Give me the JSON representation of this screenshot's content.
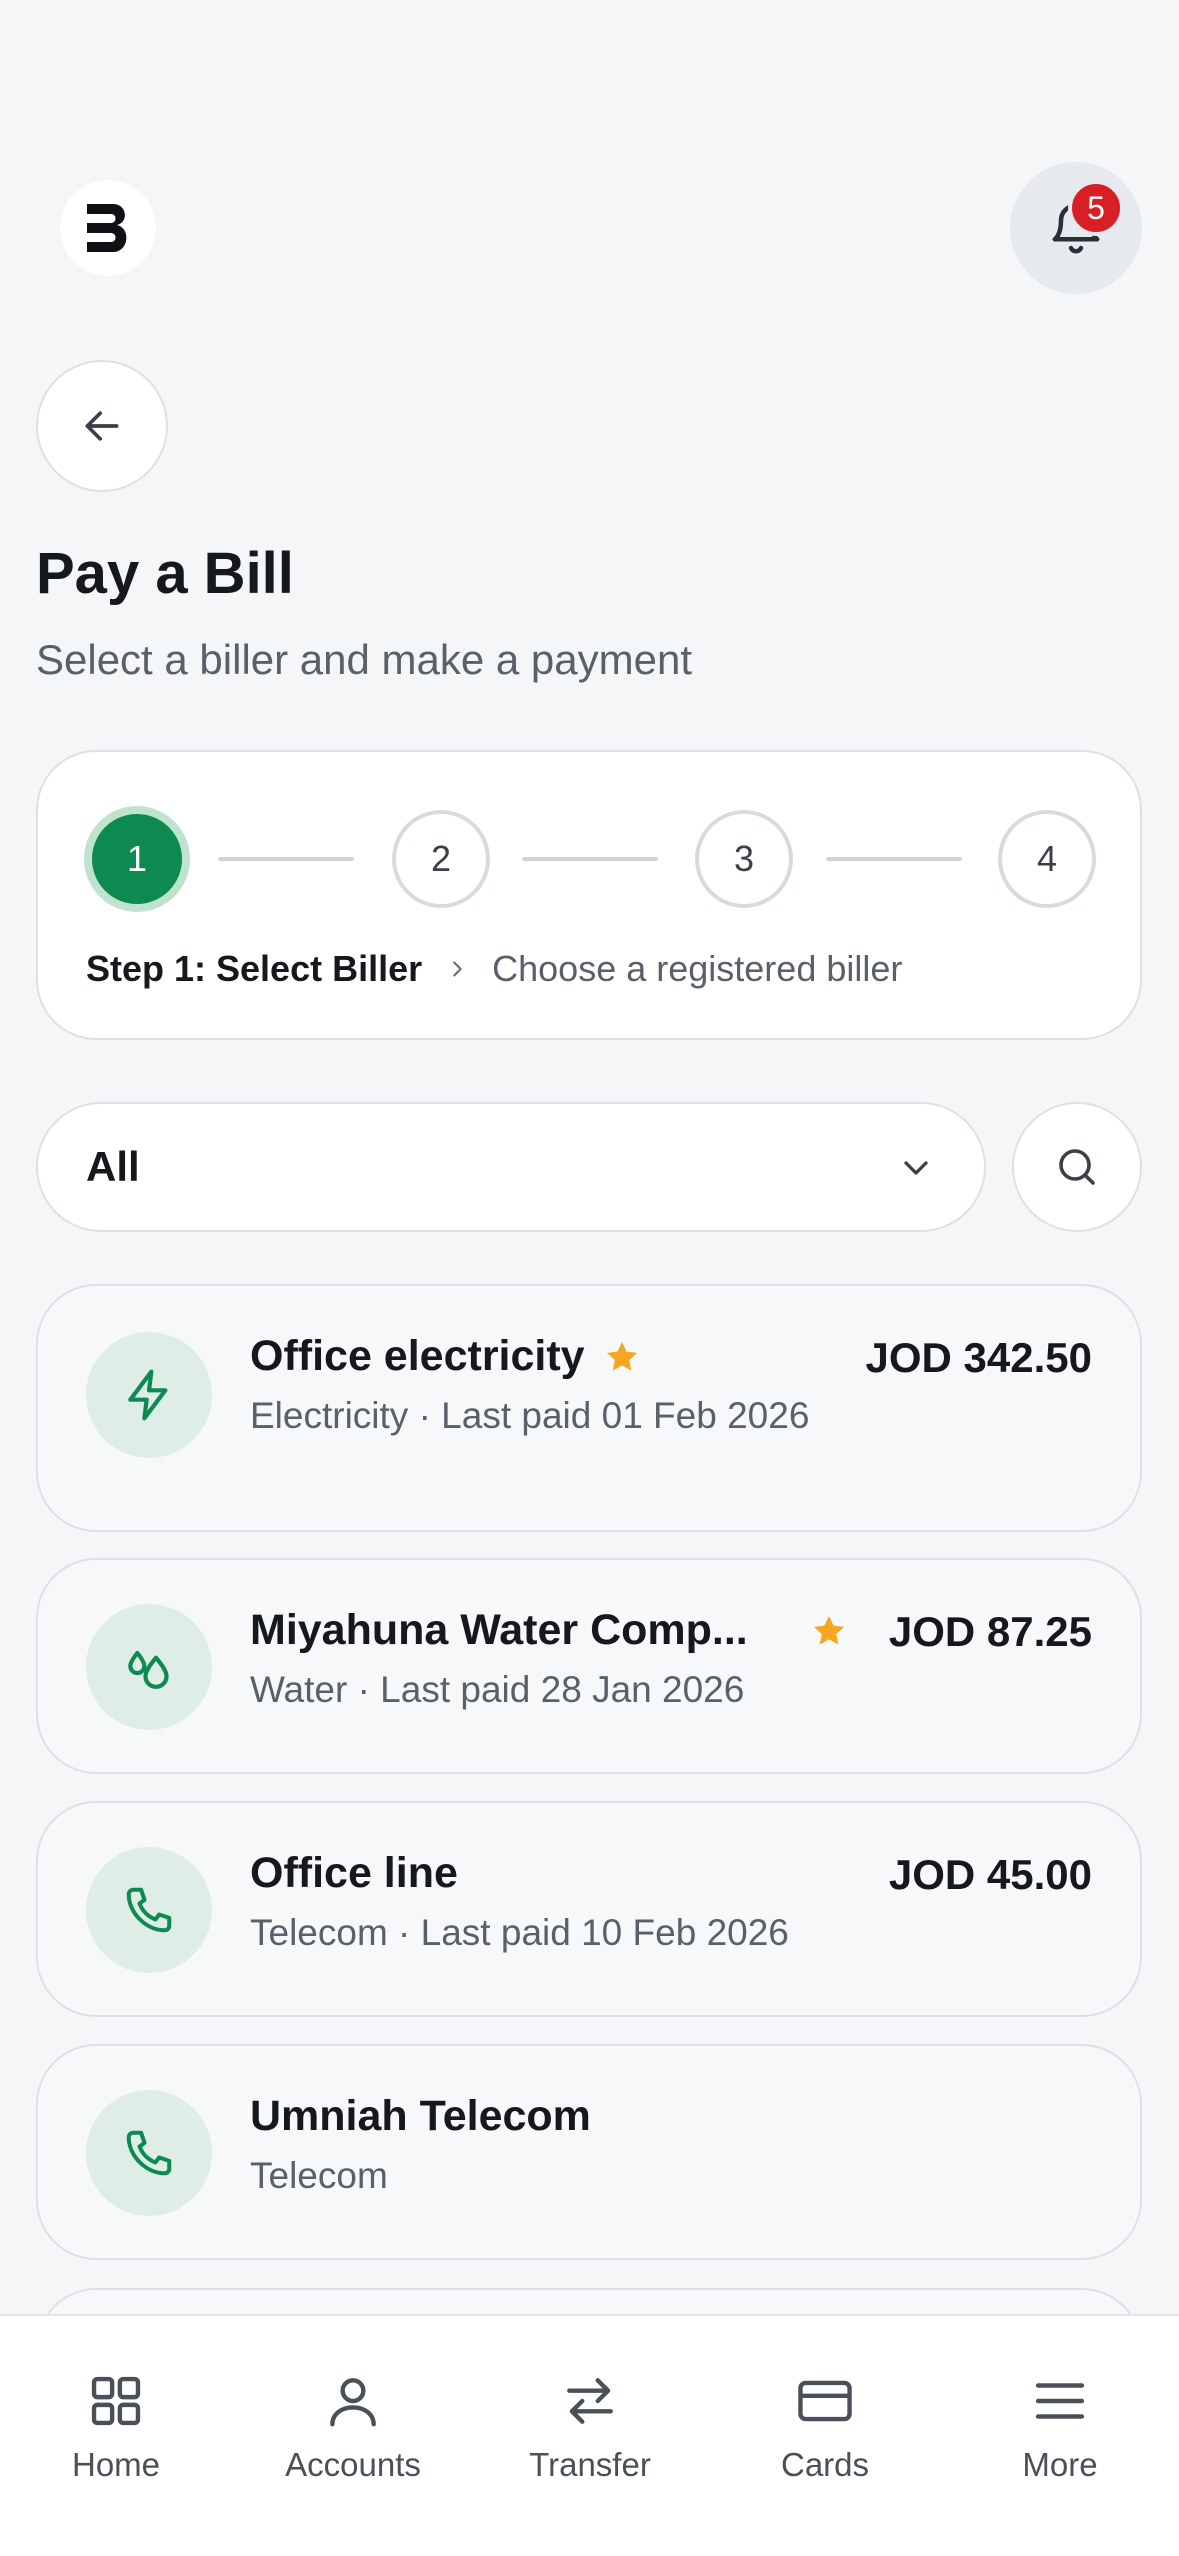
{
  "header": {
    "notifications_count": "5"
  },
  "page": {
    "title": "Pay a Bill",
    "subtitle": "Select a biller and make a payment"
  },
  "stepper": {
    "steps": [
      "1",
      "2",
      "3",
      "4"
    ],
    "active_step": 1,
    "current_label": "Step 1: Select Biller",
    "current_description": "Choose a registered biller"
  },
  "filter": {
    "selected": "All"
  },
  "billers": [
    {
      "name": "Office electricity",
      "meta": "Electricity · Last paid 01 Feb 2026",
      "amount": "JOD 342.50",
      "favorite": true,
      "icon": "lightning-icon"
    },
    {
      "name": "Miyahuna Water Comp...",
      "meta": "Water · Last paid 28 Jan 2026",
      "amount": "JOD 87.25",
      "favorite": true,
      "icon": "water-drops-icon"
    },
    {
      "name": "Office line",
      "meta": "Telecom · Last paid 10 Feb 2026",
      "amount": "JOD 45.00",
      "favorite": false,
      "icon": "phone-icon"
    },
    {
      "name": "Umniah Telecom",
      "meta": "Telecom",
      "amount": "",
      "favorite": false,
      "icon": "phone-icon"
    }
  ],
  "nav": {
    "items": [
      {
        "label": "Home",
        "icon": "grid-icon"
      },
      {
        "label": "Accounts",
        "icon": "user-icon"
      },
      {
        "label": "Transfer",
        "icon": "transfer-arrows-icon"
      },
      {
        "label": "Cards",
        "icon": "card-icon"
      },
      {
        "label": "More",
        "icon": "menu-icon"
      }
    ]
  },
  "colors": {
    "accent": "#0d8a4f",
    "badge": "#d81f26",
    "star": "#f5a623"
  }
}
